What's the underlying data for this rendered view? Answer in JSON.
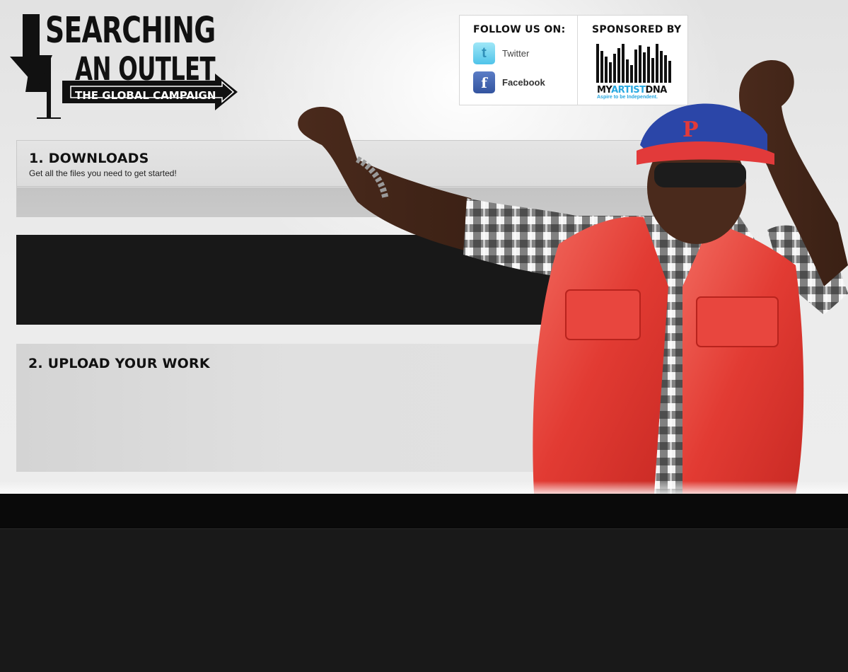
{
  "logo": {
    "line1": "SEARCHING",
    "line2": "AN OUTLET",
    "line3": "THE GLOBAL CAMPAIGN",
    "numeral": "4"
  },
  "follow": {
    "title": "FOLLOW US ON:",
    "links": [
      {
        "label": "Twitter",
        "icon": "twitter-icon",
        "color": "#4fc3e9"
      },
      {
        "label": "Facebook",
        "icon": "facebook-icon",
        "color": "#3b5998"
      }
    ]
  },
  "sponsor": {
    "title": "SPONSORED BY",
    "name_part1": "MY",
    "name_part2": "ARTIST",
    "name_part3": "DNA",
    "tagline": "Aspire to be Independent.",
    "accent_color": "#29a8e0"
  },
  "sections": [
    {
      "title": "1. DOWNLOADS",
      "subtitle": "Get all the files you need to get started!"
    },
    {
      "title": "2. UPLOAD YOUR WORK"
    }
  ],
  "colors": {
    "cap": "#2b46a8",
    "cap_brim": "#e23a3a",
    "vest": "#e8403a",
    "footer_bar": "#0a0a0a",
    "footer_body": "#191919"
  }
}
